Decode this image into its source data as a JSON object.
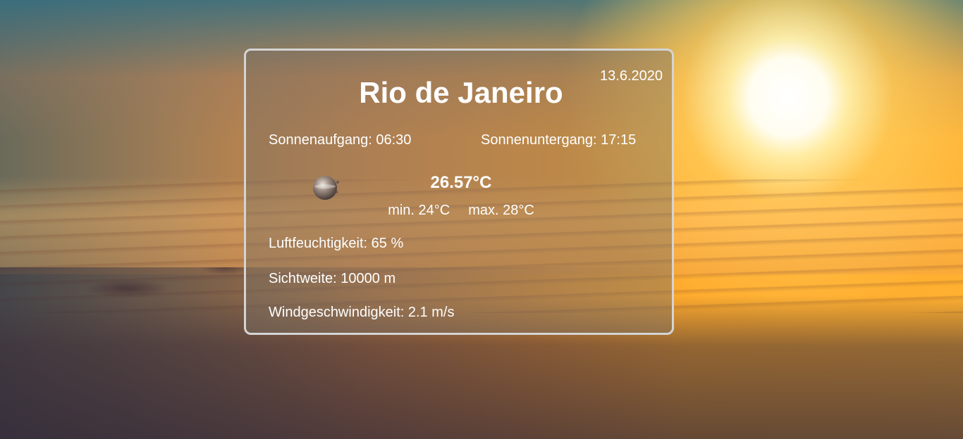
{
  "weather": {
    "date": "13.6.2020",
    "city": "Rio de Janeiro",
    "sunrise": "Sonnenaufgang: 06:30",
    "sunset": "Sonnenuntergang: 17:15",
    "icon": "cloud-sphere-icon",
    "temperature": "26.57°C",
    "min": "min. 24°C",
    "max": "max. 28°C",
    "humidity": "Luftfeuchtigkeit: 65 %",
    "visibility": "Sichtweite: 10000 m",
    "wind": "Windgeschwindigkeit: 2.1 m/s"
  },
  "colors": {
    "card_border": "#d4d4d4",
    "text": "#ffffff",
    "sky_orange": "#ffab2d"
  }
}
